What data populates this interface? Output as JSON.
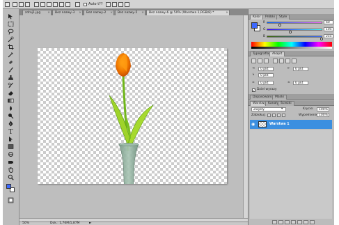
{
  "options_bar": {
    "auto_label": "Auto t??"
  },
  "tabs": [
    {
      "label": "zdroj1.jpg"
    },
    {
      "label": "Bez nazwy-3"
    },
    {
      "label": "Bez nazwy-2"
    },
    {
      "label": "Bez nazwy-5"
    },
    {
      "label": "Bez nazwy-6 @ 50% (Warstwa 1,RGB/8) *"
    }
  ],
  "status": {
    "zoom": "50%",
    "doc_size": "Dok.: 1,76M/1,87M"
  },
  "color_panel": {
    "tabs": [
      "Kolor",
      "Próbki",
      "Style"
    ],
    "channels": [
      {
        "letter": "R",
        "value": "60"
      },
      {
        "letter": "G",
        "value": "105"
      },
      {
        "letter": "B",
        "value": "255"
      }
    ],
    "fg_color": "#3c69ff"
  },
  "paragraph_panel": {
    "tabs": [
      "Typografia",
      "Akapit"
    ],
    "fields": [
      "0 pkt",
      "0 pkt",
      "0 pkt",
      "0 pkt",
      "0 pkt"
    ],
    "hyphenate_label": "Dziel wyrazy"
  },
  "adjust_panel": {
    "tabs": [
      "Dopasowania",
      "Maski"
    ]
  },
  "layers_panel": {
    "tabs": [
      "Warstwy",
      "Kanały",
      "Ścieżki"
    ],
    "blend_mode": "Zwykły",
    "opacity_label": "Krycie:",
    "opacity_value": "100%",
    "lock_label": "Zablokuj:",
    "fill_label": "Wypełnienie:",
    "fill_value": "100%",
    "layers": [
      {
        "name": "Warstwa 1",
        "selected": true
      }
    ],
    "selected_color": "#3b8fe0"
  },
  "tools": {
    "icons": [
      "move-icon",
      "marquee-icon",
      "lasso-icon",
      "quick-select-icon",
      "crop-icon",
      "eyedropper-icon",
      "healing-icon",
      "brush-icon",
      "stamp-icon",
      "history-brush-icon",
      "eraser-icon",
      "gradient-icon",
      "blur-icon",
      "dodge-icon",
      "pen-icon",
      "type-icon",
      "path-select-icon",
      "shape-icon",
      "3d-rotate-icon",
      "3d-camera-icon",
      "hand-icon",
      "zoom-icon"
    ],
    "fg": "#3c69ff",
    "bg": "#ffffff"
  }
}
